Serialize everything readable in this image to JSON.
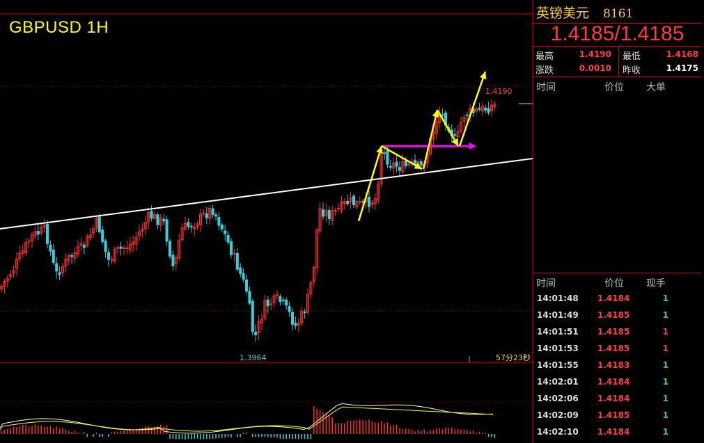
{
  "chart": {
    "title": "GBPUSD 1H",
    "high_label": "1.4190",
    "low_label": "1.3964",
    "countdown": "57分23秒"
  },
  "quote": {
    "name": "英镑美元",
    "code": "8161",
    "price": "1.4185/1.4185",
    "stats": {
      "high_label": "最高",
      "high": "1.4190",
      "low_label": "最低",
      "low": "1.4168",
      "change_label": "涨跌",
      "change": "0.0010",
      "prev_label": "昨收",
      "prev": "1.4175"
    },
    "block_headers": {
      "time": "时间",
      "price": "价位",
      "big": "大单"
    },
    "tick_headers": {
      "time": "时间",
      "price": "价位",
      "vol": "现手"
    },
    "ticks": [
      {
        "time": "14:01:48",
        "price": "1.4184",
        "vol": "1",
        "dir": "green"
      },
      {
        "time": "14:01:49",
        "price": "1.4185",
        "vol": "1",
        "dir": "green"
      },
      {
        "time": "14:01:51",
        "price": "1.4185",
        "vol": "1",
        "dir": "red"
      },
      {
        "time": "14:01:53",
        "price": "1.4185",
        "vol": "1",
        "dir": "red"
      },
      {
        "time": "14:01:55",
        "price": "1.4183",
        "vol": "1",
        "dir": "green"
      },
      {
        "time": "14:02:01",
        "price": "1.4184",
        "vol": "1",
        "dir": "green"
      },
      {
        "time": "14:02:06",
        "price": "1.4184",
        "vol": "1",
        "dir": "green"
      },
      {
        "time": "14:02:09",
        "price": "1.4185",
        "vol": "1",
        "dir": "green"
      },
      {
        "time": "14:02:10",
        "price": "1.4184",
        "vol": "1",
        "dir": "green"
      }
    ]
  },
  "colors": {
    "up": "#ff3030",
    "down": "#34d0dc",
    "trend": "#ffffff",
    "arrow": "#ffff00",
    "level": "#ff00ff",
    "grid": "#8b0000"
  }
}
